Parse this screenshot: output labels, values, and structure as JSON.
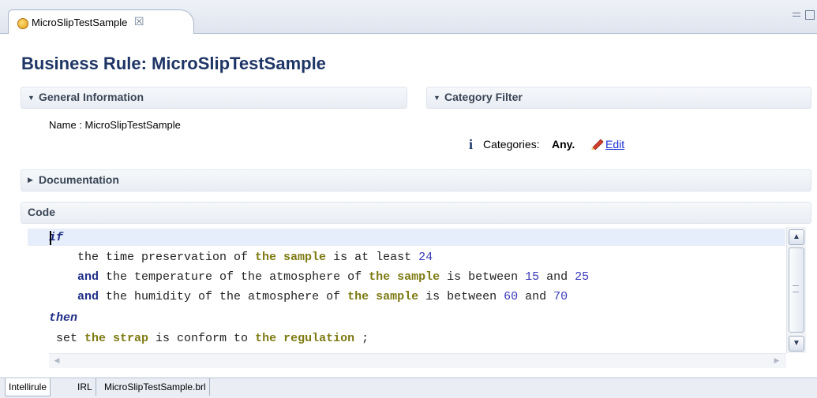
{
  "editor_tab": {
    "label": "MicroSlipTestSample",
    "close_glyph": "☒"
  },
  "form": {
    "title": "Business Rule: MicroSlipTestSample"
  },
  "general_information": {
    "title": "General Information",
    "name_label": "Name :",
    "name_value": "MicroSlipTestSample"
  },
  "category_filter": {
    "title": "Category Filter",
    "categories_label": "Categories:",
    "categories_value": "Any.",
    "edit_label": "Edit",
    "info_glyph": "i"
  },
  "documentation": {
    "title": "Documentation"
  },
  "code": {
    "title": "Code",
    "lines": [
      [
        {
          "t": "if",
          "c": "kwi"
        }
      ],
      [
        {
          "t": "    the time preservation of ",
          "c": "plain"
        },
        {
          "t": "the sample",
          "c": "obj"
        },
        {
          "t": " is at least ",
          "c": "plain"
        },
        {
          "t": "24",
          "c": "num"
        }
      ],
      [
        {
          "t": "    ",
          "c": "plain"
        },
        {
          "t": "and",
          "c": "kw"
        },
        {
          "t": " the temperature of the atmosphere of ",
          "c": "plain"
        },
        {
          "t": "the sample",
          "c": "obj"
        },
        {
          "t": " is between ",
          "c": "plain"
        },
        {
          "t": "15",
          "c": "num"
        },
        {
          "t": " and ",
          "c": "plain"
        },
        {
          "t": "25",
          "c": "num"
        }
      ],
      [
        {
          "t": "    ",
          "c": "plain"
        },
        {
          "t": "and",
          "c": "kw"
        },
        {
          "t": " the humidity of the atmosphere of ",
          "c": "plain"
        },
        {
          "t": "the sample",
          "c": "obj"
        },
        {
          "t": " is between ",
          "c": "plain"
        },
        {
          "t": "60",
          "c": "num"
        },
        {
          "t": " and ",
          "c": "plain"
        },
        {
          "t": "70",
          "c": "num"
        }
      ],
      [
        {
          "t": "then",
          "c": "kwi"
        }
      ],
      [
        {
          "t": " set ",
          "c": "plain"
        },
        {
          "t": "the strap",
          "c": "obj"
        },
        {
          "t": " is conform to ",
          "c": "plain"
        },
        {
          "t": "the regulation",
          "c": "obj"
        },
        {
          "t": " ;",
          "c": "plain"
        }
      ]
    ]
  },
  "bottom_tabs": [
    {
      "label": "Intellirule",
      "active": true
    },
    {
      "label": "IRL",
      "active": false
    },
    {
      "label": "MicroSlipTestSample.brl",
      "active": false
    }
  ],
  "colors": {
    "title": "#1e3566",
    "keyword": "#1e2e86",
    "business_object": "#7d7a12",
    "number": "#3a3ab8",
    "link": "#1a2fd6",
    "current_line": "#e6eefb"
  },
  "icons": {
    "tab": "business-rule-icon",
    "info": "info-icon",
    "edit": "pencil-icon"
  }
}
